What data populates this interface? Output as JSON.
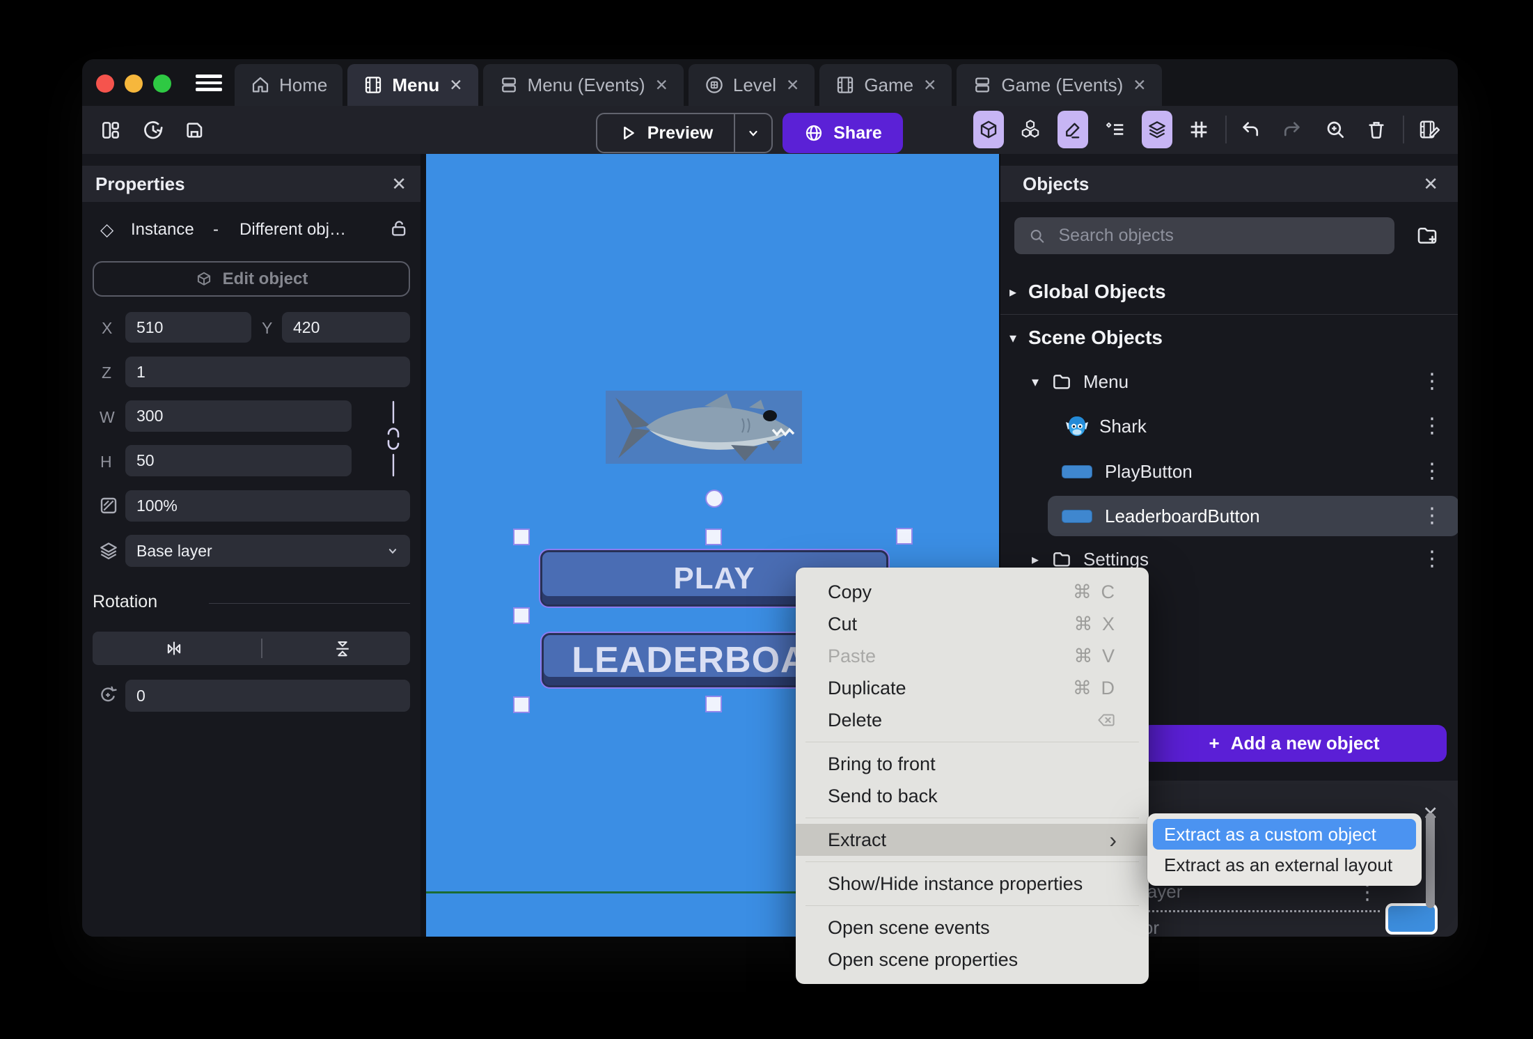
{
  "window": {
    "tabs": [
      {
        "label": "Home"
      },
      {
        "label": "Menu"
      },
      {
        "label": "Menu (Events)"
      },
      {
        "label": "Level"
      },
      {
        "label": "Game"
      },
      {
        "label": "Game (Events)"
      }
    ]
  },
  "toolbar": {
    "preview_label": "Preview",
    "share_label": "Share"
  },
  "properties": {
    "title": "Properties",
    "instance_label": "Instance",
    "instance_separator": "-",
    "instance_object": "Different obj…",
    "edit_object_label": "Edit object",
    "x_label": "X",
    "x_value": "510",
    "y_label": "Y",
    "y_value": "420",
    "z_label": "Z",
    "z_value": "1",
    "w_label": "W",
    "w_value": "300",
    "h_label": "H",
    "h_value": "50",
    "opacity_value": "100%",
    "layer_value": "Base layer",
    "rotation_title": "Rotation",
    "rotation_value": "0"
  },
  "canvas": {
    "play_label": "PLAY",
    "leaderboard_label": "LEADERBOARD"
  },
  "objects": {
    "title": "Objects",
    "search_placeholder": "Search objects",
    "global_label": "Global Objects",
    "scene_label": "Scene Objects",
    "menu_folder_label": "Menu",
    "shark_label": "Shark",
    "play_button_label": "PlayButton",
    "leaderboard_button_label": "LeaderboardButton",
    "settings_folder_label": "Settings",
    "add_object_label": "Add a new object",
    "add_plus": "+"
  },
  "context_menu": {
    "items": [
      {
        "label": "Copy",
        "shortcut": "⌘ C"
      },
      {
        "label": "Cut",
        "shortcut": "⌘ X"
      },
      {
        "label": "Paste",
        "shortcut": "⌘ V"
      },
      {
        "label": "Duplicate",
        "shortcut": "⌘ D"
      },
      {
        "label": "Delete",
        "shortcut": ""
      },
      {
        "label": "Bring to front",
        "shortcut": ""
      },
      {
        "label": "Send to back",
        "shortcut": ""
      },
      {
        "label": "Extract",
        "shortcut": ""
      },
      {
        "label": "Show/Hide instance properties",
        "shortcut": ""
      },
      {
        "label": "Open scene events",
        "shortcut": ""
      },
      {
        "label": "Open scene properties",
        "shortcut": ""
      }
    ],
    "submenu_arrow": "›"
  },
  "submenu": {
    "items": [
      {
        "label": "Extract as a custom object"
      },
      {
        "label": "Extract as an external layout"
      }
    ]
  },
  "bottom_panel": {
    "layer_text": "layer",
    "color_text": "d color"
  },
  "glyphs": {
    "close": "✕",
    "expand": "▸",
    "collapse": "▾",
    "kebab": "⋮",
    "diamond": "◇"
  },
  "colors": {
    "accent_purple": "#5b21d6",
    "canvas_blue": "#3b8ee4",
    "selection_purple": "#8d7cf0",
    "highlight_blue": "#4b93f1",
    "game_button_blue": "#4a6db4",
    "swatch_blue": "#3d8fe0"
  }
}
